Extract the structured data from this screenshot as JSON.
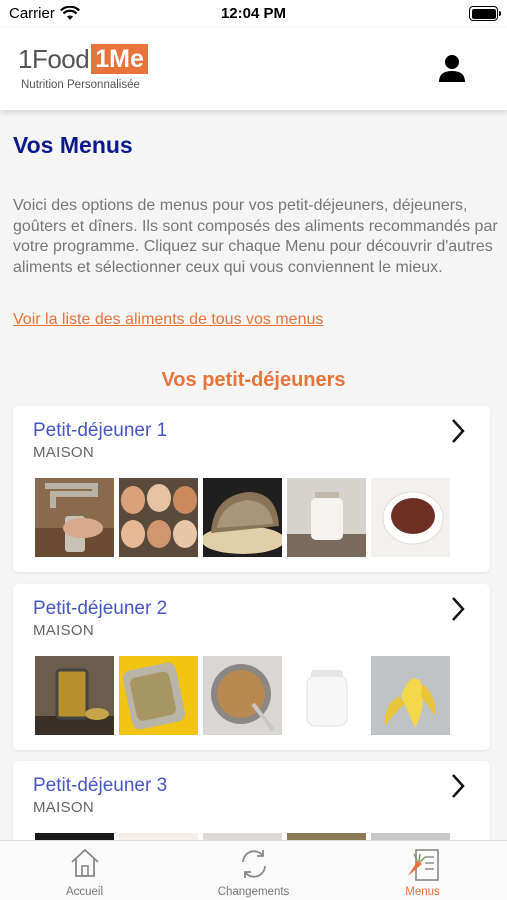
{
  "status_bar": {
    "carrier": "Carrier",
    "time": "12:04 PM"
  },
  "header": {
    "logo_food": "1Food",
    "logo_me": "1Me",
    "logo_tagline": "Nutrition Personnalisée",
    "brand_color": "#e8743b"
  },
  "page": {
    "title": "Vos Menus",
    "intro": "Voici des options de menus pour vos petit-déjeuners, déjeuners, goûters et dîners. Ils sont composés des aliments recommandés par votre programme. Cliquez sur chaque Menu pour découvrir d'autres aliments et sélectionner ceux qui vous conviennent le mieux.",
    "all_foods_link": "Voir la liste des aliments de tous vos menus",
    "section_title": "Vos petit-déjeuners"
  },
  "menus": [
    {
      "title": "Petit-déjeuner 1",
      "subtitle": "MAISON",
      "images": [
        "tap-water",
        "eggs",
        "bread",
        "milk-jar",
        "chocolate-powder"
      ]
    },
    {
      "title": "Petit-déjeuner 2",
      "subtitle": "MAISON",
      "images": [
        "french-press-tea",
        "sardines-tin",
        "granola-bowl",
        "yogurt-jar",
        "banana"
      ]
    },
    {
      "title": "Petit-déjeuner 3",
      "subtitle": "MAISON",
      "images": [
        "dark-item",
        "light-item",
        "plate-item",
        "food-item",
        "grey-item"
      ]
    }
  ],
  "tabs": [
    {
      "label": "Accueil",
      "icon": "home-icon",
      "active": false
    },
    {
      "label": "Changements",
      "icon": "refresh-icon",
      "active": false
    },
    {
      "label": "Menus",
      "icon": "menu-list-icon",
      "active": true
    }
  ],
  "colors": {
    "title": "#0a1a8c",
    "accent": "#e8743b",
    "card_title": "#4556c9"
  }
}
